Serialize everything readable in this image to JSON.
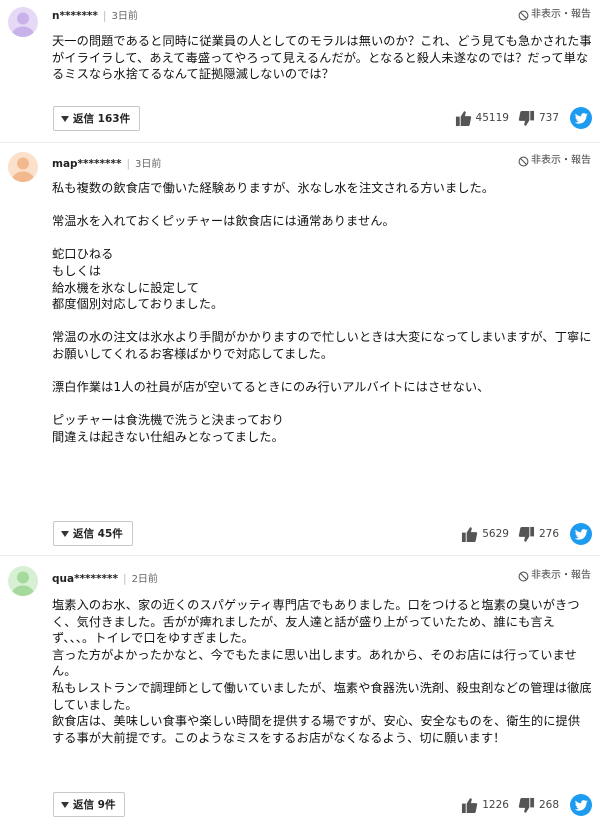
{
  "comments": [
    {
      "user": "n*******",
      "time": "3日前",
      "report": "非表示・報告",
      "paragraphs": [
        "天一の問題であると同時に従業員の人としてのモラルは無いのか？これ、どう見ても急かされた事がイライラして、あえて毒盛ってやろって見えるんだが。となると殺人未遂なのでは？だって単なるミスなら水捨てるなんて証拠隠滅しないのでは？"
      ],
      "reply_label": "返信 163件",
      "likes": "45119",
      "dislikes": "737",
      "avatar_color": "#e6d9f5",
      "avatar_face": "#c9b2ea"
    },
    {
      "user": "map********",
      "time": "3日前",
      "report": "非表示・報告",
      "paragraphs": [
        "私も複数の飲食店で働いた経験ありますが、氷なし水を注文される方いました。",
        "",
        "常温水を入れておくピッチャーは飲食店には通常ありません。",
        "",
        "蛇口ひねる",
        "もしくは",
        "給水機を氷なしに設定して",
        "都度個別対応しておりました。",
        "",
        "常温の水の注文は氷水より手間がかかりますので忙しいときは大変になってしまいますが、丁寧にお願いしてくれるお客様ばかりで対応してました。",
        "",
        "漂白作業は1人の社員が店が空いてるときにのみ行いアルバイトにはさせない、",
        "",
        "ピッチャーは食洗機で洗うと決まっており",
        "間違えは起きない仕組みとなってました。"
      ],
      "reply_label": "返信 45件",
      "likes": "5629",
      "dislikes": "276",
      "avatar_color": "#fbe0cc",
      "avatar_face": "#f2b98f"
    },
    {
      "user": "qua********",
      "time": "2日前",
      "report": "非表示・報告",
      "paragraphs": [
        "塩素入のお水、家の近くのスパゲッティ専門店でもありました。口をつけると塩素の臭いがきつく、気付きました。舌がが痺れましたが、友人達と話が盛り上がっていたため、誰にも言えず、、、。トイレで口をゆすぎました。",
        "言った方がよかったかなと、今でもたまに思い出します。あれから、そのお店には行っていません。",
        "私もレストランで調理師として働いていましたが、塩素や食器洗い洗剤、殺虫剤などの管理は徹底していました。",
        "飲食店は、美味しい食事や楽しい時間を提供する場ですが、安心、安全なものを、衛生的に提供する事が大前提です。このようなミスをするお店がなくなるよう、切に願います！"
      ],
      "reply_label": "返信 9件",
      "likes": "1226",
      "dislikes": "268",
      "avatar_color": "#d7f0d3",
      "avatar_face": "#a6d99c"
    }
  ],
  "icons": {
    "avatar": "person-silhouette-icon",
    "report": "hide-circle-slash-icon",
    "reply": "triangle-down-icon",
    "like": "thumbs-up-icon",
    "dislike": "thumbs-down-icon",
    "share": "twitter-bird-icon"
  },
  "colors": {
    "twitter": "#1d9bf0",
    "border": "#c8c8c8",
    "divider": "#ebebeb"
  }
}
